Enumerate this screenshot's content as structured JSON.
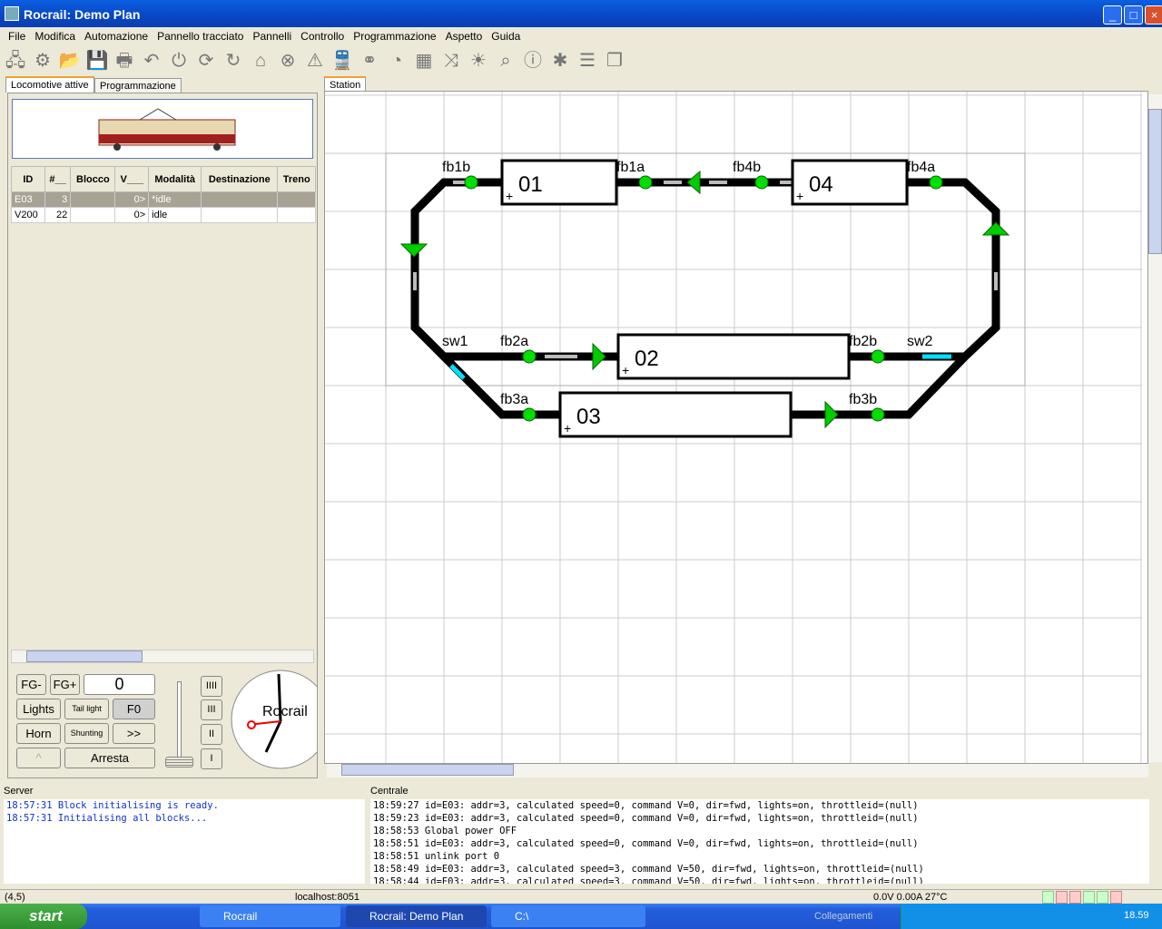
{
  "window": {
    "title": "Rocrail: Demo Plan"
  },
  "menu": [
    "File",
    "Modifica",
    "Automazione",
    "Pannello tracciato",
    "Pannelli",
    "Controllo",
    "Programmazione",
    "Aspetto",
    "Guida"
  ],
  "toolbar_icons": [
    "network-icon",
    "gears-icon",
    "open-icon",
    "save-icon",
    "print-icon",
    "undo-icon",
    "power-icon",
    "sync-icon",
    "refresh-icon",
    "home-icon",
    "stop-icon",
    "warning-icon",
    "train-icon",
    "locos-icon",
    "speedometer-icon",
    "grid-icon",
    "shuffle-icon",
    "light-icon",
    "search-icon",
    "info-icon",
    "bug-icon",
    "list-icon",
    "pages-icon"
  ],
  "left_tabs": [
    "Locomotive attive",
    "Programmazione"
  ],
  "loco_table": {
    "headers": [
      "ID",
      "#__",
      "Blocco",
      "V___",
      "Modalità",
      "Destinazione",
      "Treno"
    ],
    "rows": [
      [
        "E03",
        "3",
        "",
        "0>",
        "*idle",
        "",
        ""
      ],
      [
        "V200",
        "22",
        "",
        "0>",
        "idle",
        "",
        ""
      ]
    ]
  },
  "throttle": {
    "fg_minus": "FG-",
    "fg_plus": "FG+",
    "speed": "0",
    "lights": "Lights",
    "tail_light": "Tail light",
    "f0": "F0",
    "horn": "Horn",
    "shunting": "Shunting",
    "next": ">>",
    "up": "^",
    "stop": "Arresta",
    "steps": [
      "IIII",
      "III",
      "II",
      "I"
    ],
    "clock_brand": "Rocrail"
  },
  "plan": {
    "tab": "Station",
    "blocks": [
      "01",
      "04",
      "02",
      "03"
    ],
    "sensors": [
      "fb1b",
      "fb1a",
      "fb4b",
      "fb4a",
      "fb2a",
      "fb2b",
      "fb3a",
      "fb3b"
    ],
    "switches": [
      "sw1",
      "sw2"
    ],
    "colors": {
      "track": "#000000",
      "sensor": "#00e000",
      "signal": "#00cc00",
      "switch": "#00e0ff"
    }
  },
  "server": {
    "label": "Server",
    "lines": [
      "18:57:31 Block initialising is ready.",
      "18:57:31 Initialising all blocks..."
    ]
  },
  "centrale": {
    "label": "Centrale",
    "lines": [
      "18:59:27 id=E03: addr=3, calculated speed=0, command V=0, dir=fwd, lights=on, throttleid=(null)",
      "18:59:23 id=E03: addr=3, calculated speed=0, command V=0, dir=fwd, lights=on, throttleid=(null)",
      "18:58:53 Global power OFF",
      "18:58:51 id=E03: addr=3, calculated speed=0, command V=0, dir=fwd, lights=on, throttleid=(null)",
      "18:58:51 unlink port 0",
      "18:58:49 id=E03: addr=3, calculated speed=3, command V=50, dir=fwd, lights=on, throttleid=(null)",
      "18:58:44 id=E03: addr=3, calculated speed=3, command V=50, dir=fwd, lights=on, throttleid=(null)"
    ]
  },
  "status": {
    "coords": "(4,5)",
    "host": "localhost:8051",
    "power": "0.0V 0.00A 27°C"
  },
  "taskbar": {
    "start": "start",
    "tasks": [
      "Rocrail",
      "Rocrail: Demo Plan",
      "C:\\"
    ],
    "links": "Collegamenti",
    "time": "18.59"
  }
}
